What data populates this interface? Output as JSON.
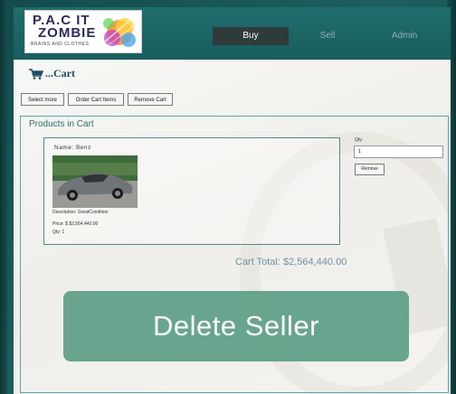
{
  "brand": {
    "logo_line1": "P.A.C IT",
    "logo_line2": "ZOMBIE",
    "logo_sub": "BRAINS AND CLOTHES"
  },
  "nav": {
    "buy": "Buy",
    "sell": "Sell",
    "admin": "Admin"
  },
  "cart": {
    "heading": "...Cart"
  },
  "toolbar": {
    "select_more": "Select more",
    "order_cart_items": "Order Cart Items",
    "remove_cart": "Remove Cart"
  },
  "products": {
    "title": "Products in Cart",
    "items": [
      {
        "name": "Name: Benz",
        "description": "Description: GreatCondition",
        "price": "Price: $ $2,564,440.00",
        "qty": "Qty: 1",
        "qty_label": "Qty:",
        "qty_value": "1",
        "remove_label": "Remove"
      }
    ],
    "total": "Cart Total: $2,564,440.00"
  },
  "overlay": {
    "delete_seller": "Delete Seller"
  },
  "colors": {
    "background": "#1e5e5e",
    "header": "#1f6d6d",
    "nav_active": "#2f3a3a",
    "overlay_button": "#5d9e86",
    "box_border": "#59a6a6"
  }
}
